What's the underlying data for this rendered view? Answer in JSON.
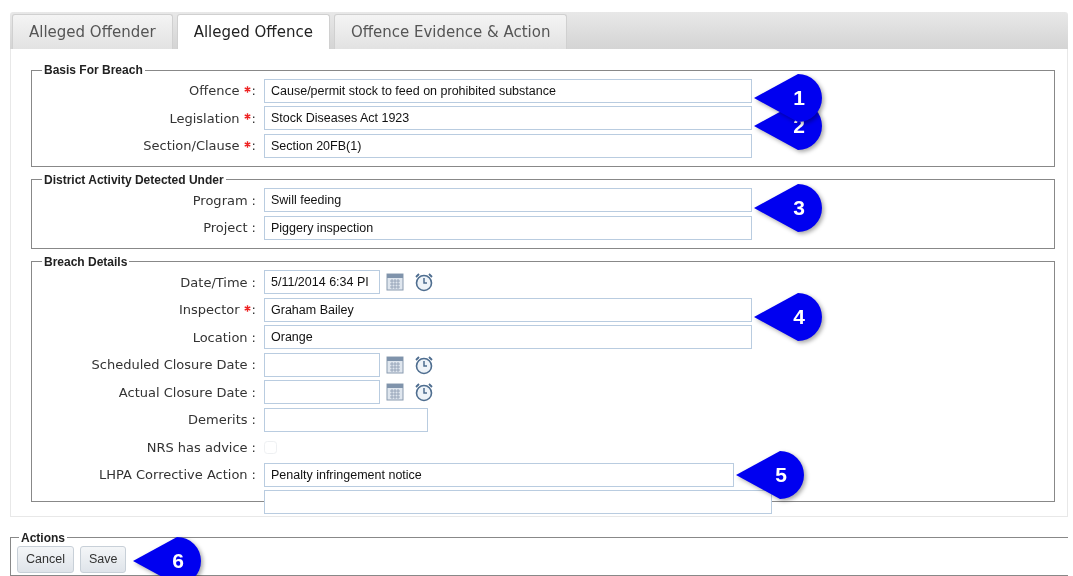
{
  "tabs": [
    {
      "label": "Alleged Offender",
      "selected": false
    },
    {
      "label": "Alleged Offence",
      "selected": true
    },
    {
      "label": "Offence Evidence & Action",
      "selected": false
    }
  ],
  "sections": [
    {
      "legend": "Basis For Breach",
      "fields": [
        {
          "kind": "text",
          "label": "Offence",
          "colon": ":",
          "required": true,
          "value": "Cause/permit stock to feed on prohibited substance",
          "callout": "1"
        },
        {
          "kind": "text",
          "label": "Legislation",
          "colon": ":",
          "required": true,
          "value": "Stock Diseases Act 1923",
          "callout": "2"
        },
        {
          "kind": "text",
          "label": "Section/Clause",
          "colon": ":",
          "required": true,
          "value": "Section 20FB(1)"
        }
      ]
    },
    {
      "legend": "District Activity Detected Under",
      "fields": [
        {
          "kind": "text",
          "label": "Program",
          "colon": ":",
          "required": false,
          "value": "Swill feeding",
          "callout": "3"
        },
        {
          "kind": "text",
          "label": "Project",
          "colon": ":",
          "required": false,
          "value": "Piggery inspection"
        }
      ]
    },
    {
      "legend": "Breach Details",
      "fields": [
        {
          "kind": "datetime",
          "label": "Date/Time",
          "colon": ":",
          "required": false,
          "value": "5/11/2014 6:34 PI"
        },
        {
          "kind": "text",
          "label": "Inspector",
          "colon": ":",
          "required": true,
          "value": "Graham Bailey",
          "callout": "4"
        },
        {
          "kind": "text",
          "label": "Location",
          "colon": ":",
          "required": false,
          "value": "Orange"
        },
        {
          "kind": "datetime",
          "label": "Scheduled Closure Date",
          "colon": ":",
          "required": false
        },
        {
          "kind": "datetime",
          "label": "Actual Closure Date",
          "colon": ":",
          "required": false
        },
        {
          "kind": "short",
          "label": "Demerits",
          "colon": ":",
          "required": false
        },
        {
          "kind": "checkbox",
          "label": "NRS has advice",
          "colon": ":",
          "required": false,
          "checked": false
        },
        {
          "kind": "action",
          "label": "LHPA Corrective Action",
          "colon": ":",
          "required": false,
          "value": "Penalty infringement notice",
          "callout": "5"
        }
      ]
    }
  ],
  "actions": {
    "legend": "Actions",
    "buttons": [
      {
        "label": "Cancel"
      },
      {
        "label": "Save",
        "callout": "6"
      }
    ]
  }
}
